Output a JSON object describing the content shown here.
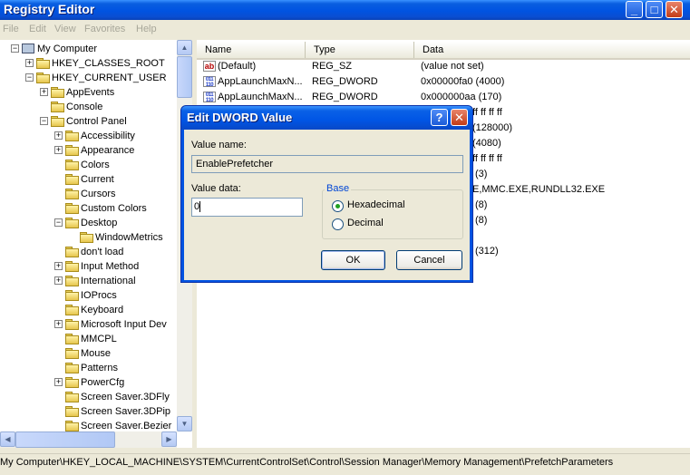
{
  "window": {
    "title": "Registry Editor",
    "minimize_glyph": "_",
    "maximize_glyph": "□",
    "close_glyph": "✕"
  },
  "menu": [
    "File",
    "Edit",
    "View",
    "Favorites",
    "Help"
  ],
  "tree": [
    {
      "label": "My Computer",
      "indent": 0,
      "expander": "−",
      "icon": "computer-icon"
    },
    {
      "label": "HKEY_CLASSES_ROOT",
      "indent": 1,
      "expander": "+",
      "icon": "folder-icon"
    },
    {
      "label": "HKEY_CURRENT_USER",
      "indent": 1,
      "expander": "−",
      "icon": "folder-icon"
    },
    {
      "label": "AppEvents",
      "indent": 2,
      "expander": "+",
      "icon": "folder-icon"
    },
    {
      "label": "Console",
      "indent": 2,
      "expander": "",
      "icon": "folder-icon"
    },
    {
      "label": "Control Panel",
      "indent": 2,
      "expander": "−",
      "icon": "folder-icon"
    },
    {
      "label": "Accessibility",
      "indent": 3,
      "expander": "+",
      "icon": "folder-icon"
    },
    {
      "label": "Appearance",
      "indent": 3,
      "expander": "+",
      "icon": "folder-icon"
    },
    {
      "label": "Colors",
      "indent": 3,
      "expander": "",
      "icon": "folder-icon"
    },
    {
      "label": "Current",
      "indent": 3,
      "expander": "",
      "icon": "folder-icon"
    },
    {
      "label": "Cursors",
      "indent": 3,
      "expander": "",
      "icon": "folder-icon"
    },
    {
      "label": "Custom Colors",
      "indent": 3,
      "expander": "",
      "icon": "folder-icon"
    },
    {
      "label": "Desktop",
      "indent": 3,
      "expander": "−",
      "icon": "folder-icon"
    },
    {
      "label": "WindowMetrics",
      "indent": 4,
      "expander": "",
      "icon": "folder-icon"
    },
    {
      "label": "don't load",
      "indent": 3,
      "expander": "",
      "icon": "folder-icon"
    },
    {
      "label": "Input Method",
      "indent": 3,
      "expander": "+",
      "icon": "folder-icon"
    },
    {
      "label": "International",
      "indent": 3,
      "expander": "+",
      "icon": "folder-icon"
    },
    {
      "label": "IOProcs",
      "indent": 3,
      "expander": "",
      "icon": "folder-icon"
    },
    {
      "label": "Keyboard",
      "indent": 3,
      "expander": "",
      "icon": "folder-icon"
    },
    {
      "label": "Microsoft Input Dev",
      "indent": 3,
      "expander": "+",
      "icon": "folder-icon"
    },
    {
      "label": "MMCPL",
      "indent": 3,
      "expander": "",
      "icon": "folder-icon"
    },
    {
      "label": "Mouse",
      "indent": 3,
      "expander": "",
      "icon": "folder-icon"
    },
    {
      "label": "Patterns",
      "indent": 3,
      "expander": "",
      "icon": "folder-icon"
    },
    {
      "label": "PowerCfg",
      "indent": 3,
      "expander": "+",
      "icon": "folder-icon"
    },
    {
      "label": "Screen Saver.3DFly",
      "indent": 3,
      "expander": "",
      "icon": "folder-icon"
    },
    {
      "label": "Screen Saver.3DPip",
      "indent": 3,
      "expander": "",
      "icon": "folder-icon"
    },
    {
      "label": "Screen Saver.Bezier",
      "indent": 3,
      "expander": "",
      "icon": "folder-icon"
    }
  ],
  "columns": [
    "Name",
    "Type",
    "Data"
  ],
  "values": [
    {
      "name": "(Default)",
      "type": "REG_SZ",
      "data": "(value not set)",
      "icon": "string-value-icon"
    },
    {
      "name": "AppLaunchMaxN...",
      "type": "REG_DWORD",
      "data": "0x00000fa0 (4000)",
      "icon": "binary-value-icon"
    },
    {
      "name": "AppLaunchMaxN...",
      "type": "REG_DWORD",
      "data": "0x000000aa (170)",
      "icon": "binary-value-icon"
    }
  ],
  "values_partial": [
    {
      "data": "ff ff ff ff"
    },
    {
      "data": "(128000)"
    },
    {
      "data": "(4080)"
    },
    {
      "data": "ff ff ff ff"
    },
    {
      "data": "(3)"
    },
    {
      "data": "E,MMC.EXE,RUNDLL32.EXE"
    },
    {
      "data": "(8)"
    },
    {
      "data": "(8)"
    },
    {
      "data": "(312)"
    }
  ],
  "status_path": "My Computer\\HKEY_LOCAL_MACHINE\\SYSTEM\\CurrentControlSet\\Control\\Session Manager\\Memory Management\\PrefetchParameters",
  "dialog": {
    "title": "Edit DWORD Value",
    "help_glyph": "?",
    "close_glyph": "✕",
    "value_name_label": "Value name:",
    "value_name": "EnablePrefetcher",
    "value_data_label": "Value data:",
    "value_data": "0",
    "base_label": "Base",
    "hex_label": "Hexadecimal",
    "dec_label": "Decimal",
    "selected_base": "hexadecimal",
    "ok_label": "OK",
    "cancel_label": "Cancel"
  },
  "colors": {
    "titlebar": "#0053e1",
    "group_legend": "#0046d5"
  }
}
